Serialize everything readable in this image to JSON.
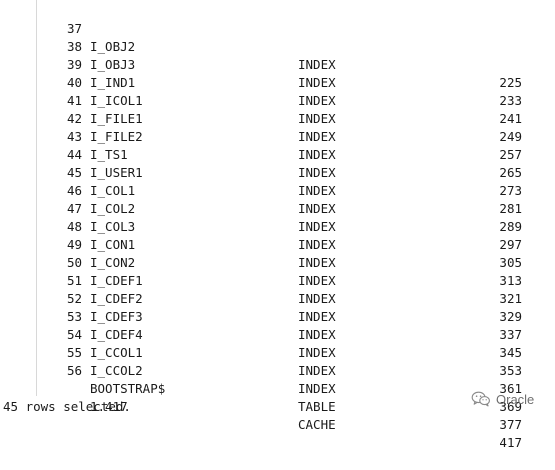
{
  "rows": [
    {
      "id": "37",
      "name": "I_OBJ2",
      "type": "INDEX",
      "value": "225"
    },
    {
      "id": "38",
      "name": "I_OBJ3",
      "type": "INDEX",
      "value": "233"
    },
    {
      "id": "39",
      "name": "I_IND1",
      "type": "INDEX",
      "value": "241"
    },
    {
      "id": "40",
      "name": "I_ICOL1",
      "type": "INDEX",
      "value": "249"
    },
    {
      "id": "41",
      "name": "I_FILE1",
      "type": "INDEX",
      "value": "257"
    },
    {
      "id": "42",
      "name": "I_FILE2",
      "type": "INDEX",
      "value": "265"
    },
    {
      "id": "43",
      "name": "I_TS1",
      "type": "INDEX",
      "value": "273"
    },
    {
      "id": "44",
      "name": "I_USER1",
      "type": "INDEX",
      "value": "281"
    },
    {
      "id": "45",
      "name": "I_COL1",
      "type": "INDEX",
      "value": "289"
    },
    {
      "id": "46",
      "name": "I_COL2",
      "type": "INDEX",
      "value": "297"
    },
    {
      "id": "47",
      "name": "I_COL3",
      "type": "INDEX",
      "value": "305"
    },
    {
      "id": "48",
      "name": "I_CON1",
      "type": "INDEX",
      "value": "313"
    },
    {
      "id": "49",
      "name": "I_CON2",
      "type": "INDEX",
      "value": "321"
    },
    {
      "id": "50",
      "name": "I_CDEF1",
      "type": "INDEX",
      "value": "329"
    },
    {
      "id": "51",
      "name": "I_CDEF2",
      "type": "INDEX",
      "value": "337"
    },
    {
      "id": "52",
      "name": "I_CDEF3",
      "type": "INDEX",
      "value": "345"
    },
    {
      "id": "53",
      "name": "I_CDEF4",
      "type": "INDEX",
      "value": "353"
    },
    {
      "id": "54",
      "name": "I_CCOL1",
      "type": "INDEX",
      "value": "361"
    },
    {
      "id": "55",
      "name": "I_CCOL2",
      "type": "INDEX",
      "value": "369"
    },
    {
      "id": "56",
      "name": "BOOTSTRAP$",
      "type": "TABLE",
      "value": "377"
    },
    {
      "id": "",
      "name": "1.417",
      "type": "CACHE",
      "value": "417"
    }
  ],
  "footer": {
    "text": "45 rows selected."
  },
  "watermark": {
    "text": "Oracle",
    "icon": "wechat-icon"
  }
}
